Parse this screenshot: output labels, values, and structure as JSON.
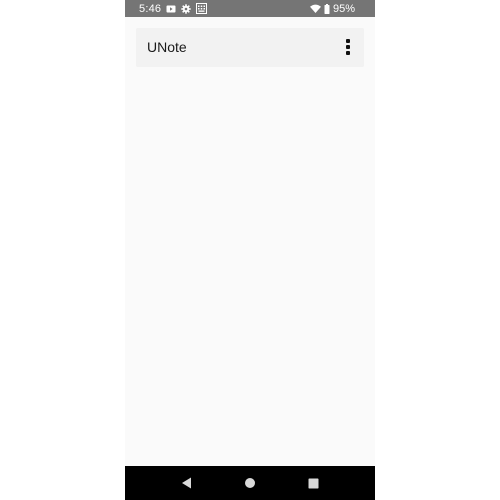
{
  "status_bar": {
    "time": "5:46",
    "battery_percent": "95%",
    "icons": [
      "video-icon",
      "settings-gear-icon",
      "keyboard-icon",
      "wifi-icon",
      "battery-icon"
    ]
  },
  "app_bar": {
    "title": "UNote",
    "overflow_icon": "more-vertical-icon"
  },
  "nav_bar": {
    "icons": [
      "back-icon",
      "home-icon",
      "recents-icon"
    ]
  },
  "colors": {
    "status_bar": "#757575",
    "app_background": "#fafafa",
    "app_bar": "#f2f2f2",
    "nav_bar": "#000000"
  }
}
